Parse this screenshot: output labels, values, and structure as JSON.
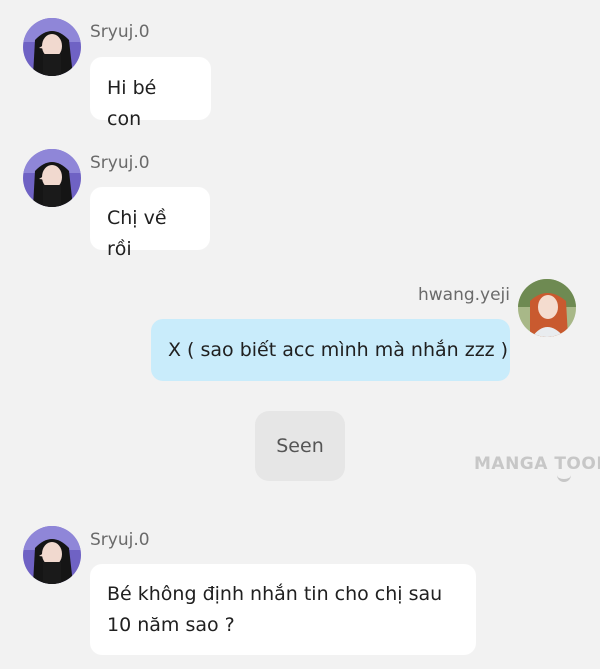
{
  "messages": [
    {
      "sender": "Sryuj.0",
      "text": "Hi bé con",
      "side": "left"
    },
    {
      "sender": "Sryuj.0",
      "text": "Chị về rồi",
      "side": "left"
    },
    {
      "sender": "hwang.yeji",
      "text": "X ( sao biết acc mình mà nhắn zzz )",
      "side": "right"
    },
    {
      "sender": "Sryuj.0",
      "text": "Bé không định nhắn tin cho chị sau 10 năm sao ?",
      "side": "left"
    }
  ],
  "status": {
    "seen_label": "Seen"
  },
  "watermark": {
    "text": "MANGA TOON"
  },
  "colors": {
    "background": "#f2f2f2",
    "left_bubble": "#ffffff",
    "right_bubble": "#c9ecfb",
    "seen_bubble": "#e6e6e6"
  }
}
